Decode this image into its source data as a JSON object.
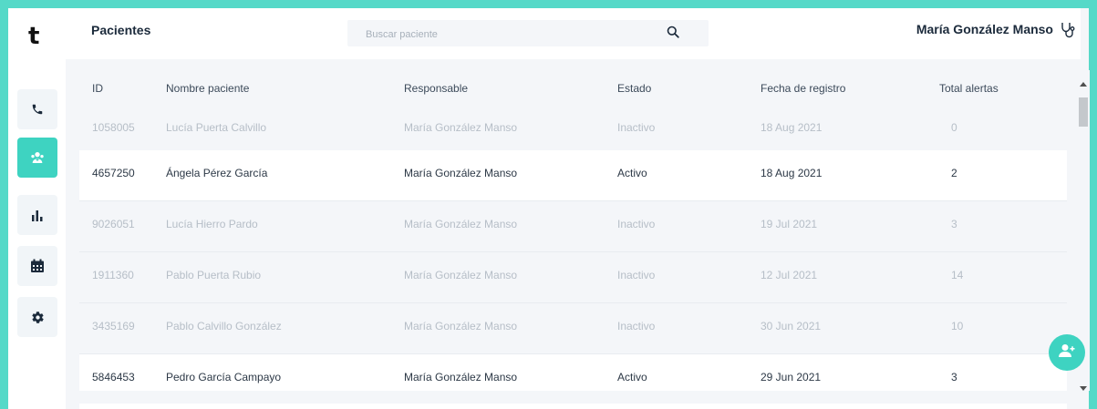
{
  "app": {
    "logo": "t"
  },
  "header": {
    "title": "Pacientes",
    "search_placeholder": "Buscar paciente",
    "user_name": "María González Manso"
  },
  "sidebar": {
    "items": [
      {
        "icon": "phone-icon"
      },
      {
        "icon": "patients-icon",
        "active": true
      },
      {
        "icon": "bar-chart-icon"
      },
      {
        "icon": "calendar-icon"
      },
      {
        "icon": "gear-icon"
      }
    ]
  },
  "table": {
    "columns": [
      "ID",
      "Nombre paciente",
      "Responsable",
      "Estado",
      "Fecha de registro",
      "Total alertas"
    ],
    "rows": [
      {
        "id": "1058005",
        "name": "Lucía Puerta Calvillo",
        "responsible": "María González Manso",
        "status": "Inactivo",
        "date": "18 Aug 2021",
        "alerts": "0"
      },
      {
        "id": "4657250",
        "name": "Ángela Pérez García",
        "responsible": "María González Manso",
        "status": "Activo",
        "date": "18 Aug 2021",
        "alerts": "2"
      },
      {
        "id": "9026051",
        "name": "Lucía Hierro Pardo",
        "responsible": "María González Manso",
        "status": "Inactivo",
        "date": "19 Jul 2021",
        "alerts": "3"
      },
      {
        "id": "1911360",
        "name": "Pablo Puerta Rubio",
        "responsible": "María González Manso",
        "status": "Inactivo",
        "date": "12 Jul 2021",
        "alerts": "14"
      },
      {
        "id": "3435169",
        "name": "Pablo Calvillo González",
        "responsible": "María González Manso",
        "status": "Inactivo",
        "date": "30 Jun 2021",
        "alerts": "10"
      },
      {
        "id": "5846453",
        "name": "Pedro García Campayo",
        "responsible": "María González Manso",
        "status": "Activo",
        "date": "29 Jun 2021",
        "alerts": "3"
      }
    ]
  },
  "fab": {
    "icon": "add-user-icon"
  },
  "colors": {
    "accent": "#3ed3c1",
    "frame": "#55d9c8",
    "inactive_text": "#b6bec7",
    "active_text": "#2c3846"
  }
}
